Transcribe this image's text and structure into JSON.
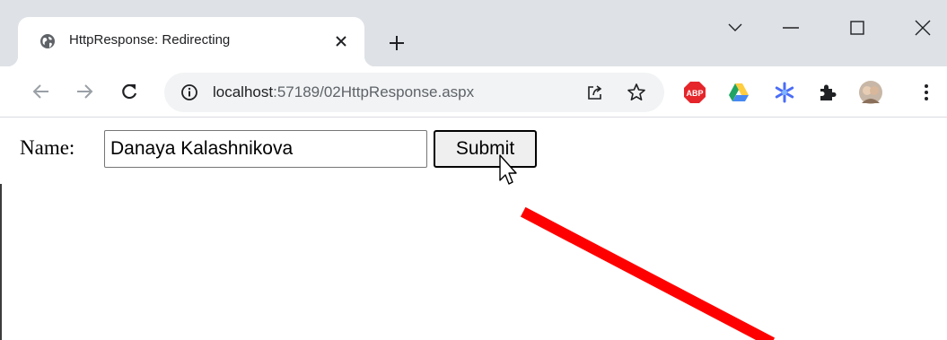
{
  "browser": {
    "tab": {
      "title": "HttpResponse: Redirecting",
      "favicon": "globe-icon",
      "close": "close-icon"
    },
    "new_tab": "plus-icon",
    "window_controls": [
      "chevron-down-icon",
      "minimize-icon",
      "maximize-icon",
      "close-icon"
    ],
    "toolbar": {
      "back": "arrow-left-icon",
      "forward": "arrow-right-icon",
      "reload": "reload-icon"
    },
    "omnibox": {
      "info_icon": "info-icon",
      "url_host": "localhost",
      "url_path": ":57189/02HttpResponse.aspx",
      "share_icon": "share-icon",
      "bookmark_icon": "star-icon"
    },
    "extensions": [
      "adblock-plus-icon",
      "google-drive-icon",
      "asterisk-extension-icon",
      "puzzle-icon",
      "profile-avatar",
      "more-vert-icon"
    ]
  },
  "form": {
    "name_label": "Name:",
    "name_value": "Danaya Kalashnikova",
    "submit_label": "Submit"
  },
  "colors": {
    "tabstrip": "#dee1e6",
    "omnibox": "#f1f3f4",
    "annotation_arrow": "#ff0000",
    "abp_red": "#e5252a"
  }
}
